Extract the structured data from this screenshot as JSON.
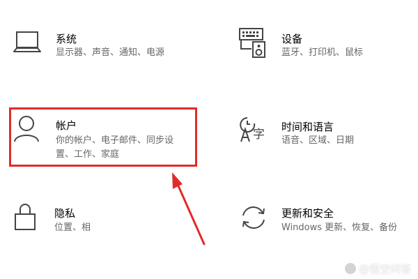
{
  "tiles": {
    "system": {
      "title": "系统",
      "desc": "显示器、声音、通知、电源",
      "icon": "laptop-icon"
    },
    "devices": {
      "title": "设备",
      "desc": "蓝牙、打印机、鼠标",
      "icon": "keyboard-speaker-icon"
    },
    "accounts": {
      "title": "帐户",
      "desc_line1": "你的帐户、电子邮件、同步设",
      "desc_line2": "置、工作、家庭",
      "icon": "person-icon"
    },
    "time_language": {
      "title": "时间和语言",
      "desc": "语音、区域、日期",
      "icon": "time-language-icon"
    },
    "privacy": {
      "title": "隐私",
      "desc": "位置、相",
      "icon": "lock-icon"
    },
    "update_security": {
      "title": "更新和安全",
      "desc": "Windows 更新、恢复、备份",
      "icon": "sync-icon"
    }
  },
  "annotation": {
    "highlight_color": "#e02b2b"
  },
  "watermark": {
    "text": "@悟空问答"
  }
}
